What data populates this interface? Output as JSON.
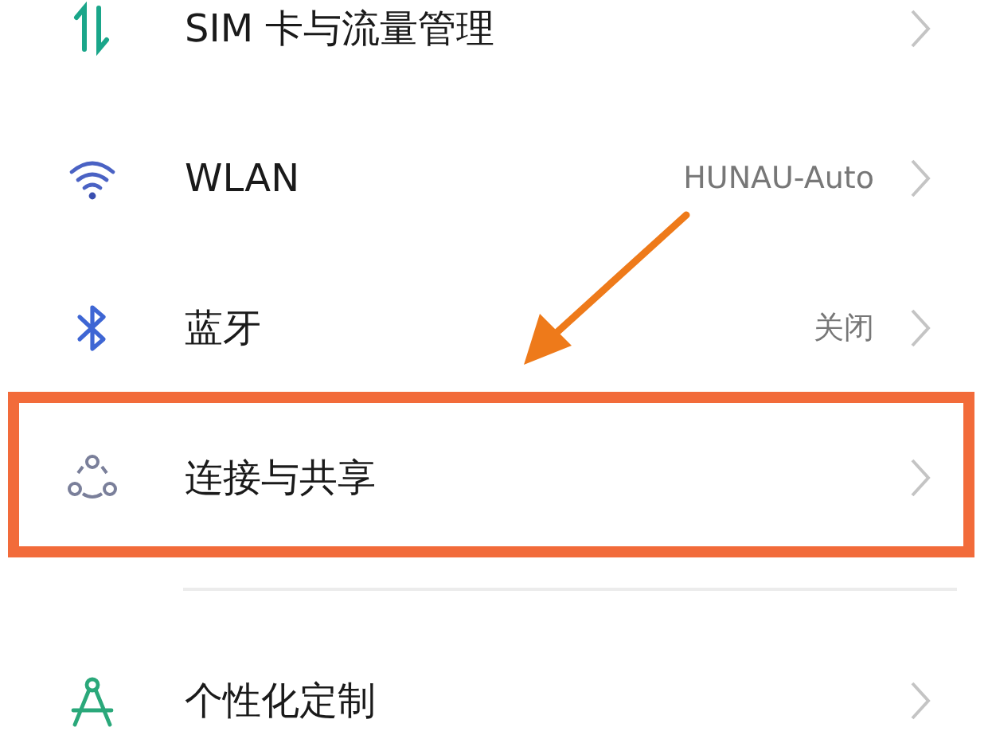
{
  "settings": [
    {
      "label": "SIM 卡与流量管理",
      "highlighted": false
    },
    {
      "label": "WLAN",
      "value": "HUNAU-Auto",
      "highlighted": false
    },
    {
      "label": "蓝牙",
      "value": "关闭",
      "highlighted": false
    },
    {
      "label": "连接与共享",
      "highlighted": true
    },
    {
      "label": "个性化定制",
      "highlighted": false,
      "divider_before": true
    }
  ]
}
